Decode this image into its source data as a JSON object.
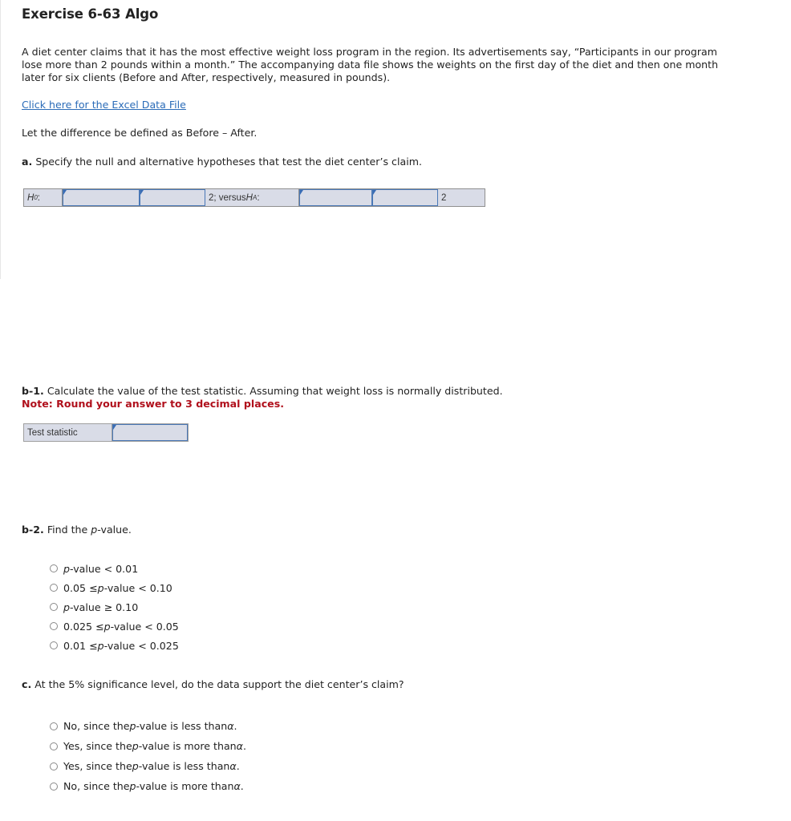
{
  "exercise": {
    "title": "Exercise 6-63 Algo",
    "intro": "A diet center claims that it has the most effective weight loss program in the region. Its advertisements say, “Participants in our program lose more than 2 pounds within a month.” The accompanying data file shows the weights on the first day of the diet and then one month later for six clients (Before and After, respectively, measured in pounds).",
    "data_link": "Click here for the Excel Data File",
    "difference_def": "Let the difference be defined as Before – After."
  },
  "part_a": {
    "label": "a.",
    "prompt": "Specify the null and alternative hypotheses that test the diet center’s claim.",
    "h0_label": "H",
    "h0_sub": "0",
    "h0_colon": ":",
    "h0_value": "2; versus ",
    "ha_label": "H",
    "ha_sub": "A",
    "ha_colon": ":",
    "ha_value": "2"
  },
  "part_b1": {
    "label": "b-1.",
    "prompt": "Calculate the value of the test statistic. Assuming that weight loss is normally distributed.",
    "note": "Note: Round your answer to 3 decimal places.",
    "field_label": "Test statistic",
    "field_value": ""
  },
  "part_b2": {
    "label": "b-2.",
    "prompt_pre": "Find the ",
    "prompt_p": "p",
    "prompt_post": "-value.",
    "options": [
      [
        "",
        "p",
        "-value < 0.01"
      ],
      [
        "0.05 ≤ ",
        "p",
        "-value < 0.10"
      ],
      [
        "",
        "p",
        "-value ≥ 0.10"
      ],
      [
        "0.025 ≤ ",
        "p",
        "-value < 0.05"
      ],
      [
        "0.01 ≤ ",
        "p",
        "-value < 0.025"
      ]
    ]
  },
  "part_c": {
    "label": "c.",
    "prompt": "At the 5% significance level, do the data support the diet center’s claim?",
    "options": [
      [
        "No, since the ",
        "p",
        "-value is less than ",
        "α",
        "."
      ],
      [
        "Yes, since the ",
        "p",
        "-value is more than ",
        "α",
        "."
      ],
      [
        "Yes, since the ",
        "p",
        "-value is less than ",
        "α",
        "."
      ],
      [
        "No, since the ",
        "p",
        "-value is more than ",
        "α",
        "."
      ]
    ]
  },
  "colors": {
    "link": "#2b6cb8",
    "note": "#b0101c",
    "input_bg": "#d9dce7",
    "input_border": "#4a78b6"
  }
}
